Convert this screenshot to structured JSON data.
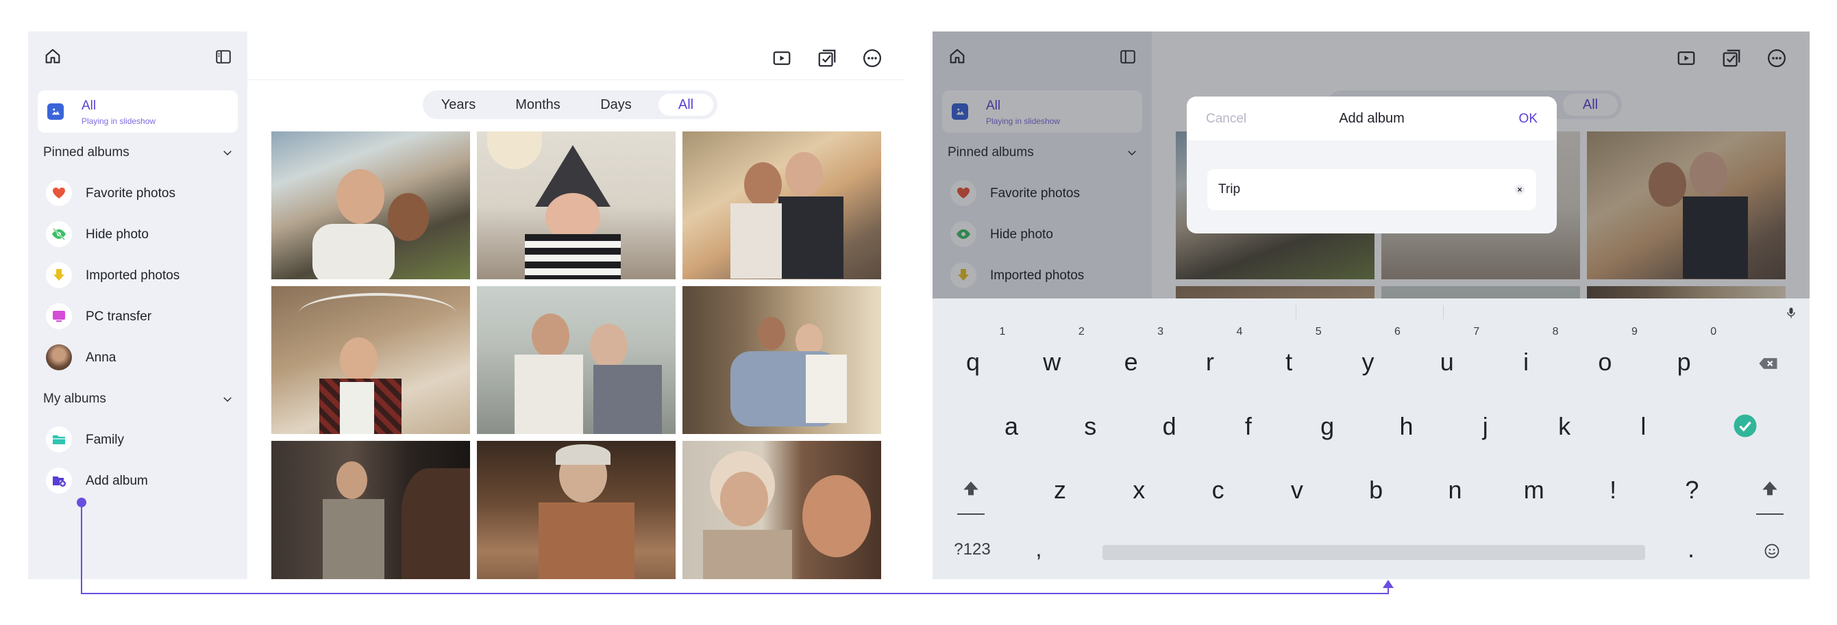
{
  "left_screen": {
    "sidebar": {
      "home_icon": "home-icon",
      "panel_icon": "sidebar-toggle-icon",
      "all": {
        "title": "All",
        "subtitle": "Playing in slideshow",
        "icon": "image-icon"
      },
      "pinned_header": "Pinned albums",
      "pinned": [
        {
          "label": "Favorite photos",
          "icon": "heart-icon",
          "color": "#e8553b"
        },
        {
          "label": "Hide photo",
          "icon": "eye-off-icon",
          "color": "#3cbf64"
        },
        {
          "label": "Imported photos",
          "icon": "download-arrow-icon",
          "color": "#e9c020"
        },
        {
          "label": "PC transfer",
          "icon": "monitor-icon",
          "color": "#d54cd8"
        },
        {
          "label": "Anna",
          "icon": "avatar-icon",
          "color": "#8a6a52"
        }
      ],
      "my_albums_header": "My albums",
      "my_albums": [
        {
          "label": "Family",
          "icon": "folder-icon",
          "color": "#2fc4b2"
        },
        {
          "label": "Add album",
          "icon": "add-folder-icon",
          "color": "#5b3fd6"
        }
      ]
    },
    "toolbar": {
      "slideshow_icon": "play-icon",
      "select_icon": "select-check-icon",
      "more_icon": "more-icon"
    },
    "tabs": [
      {
        "label": "Years",
        "selected": false
      },
      {
        "label": "Months",
        "selected": false
      },
      {
        "label": "Days",
        "selected": false
      },
      {
        "label": "All",
        "selected": true
      }
    ],
    "photos": [
      {
        "name": "photo-couple-selfie"
      },
      {
        "name": "photo-child-witch-hat"
      },
      {
        "name": "photo-couple-sofa"
      },
      {
        "name": "photo-man-thumbs-up"
      },
      {
        "name": "photo-father-son-table"
      },
      {
        "name": "photo-family-living-room"
      },
      {
        "name": "photo-older-man-doorway"
      },
      {
        "name": "photo-older-man-painting"
      },
      {
        "name": "photo-older-woman-young-man"
      }
    ]
  },
  "right_screen": {
    "sidebar": {
      "all": {
        "title": "All",
        "subtitle": "Playing in slideshow"
      },
      "pinned_header": "Pinned albums",
      "pinned": [
        {
          "label": "Favorite photos"
        },
        {
          "label": "Hide photo"
        },
        {
          "label": "Imported photos"
        }
      ]
    },
    "tab_all": "All",
    "dialog": {
      "cancel": "Cancel",
      "title": "Add album",
      "ok": "OK",
      "input_value": "Trip",
      "clear_icon": "clear-icon"
    },
    "keyboard": {
      "row1": [
        "q",
        "w",
        "e",
        "r",
        "t",
        "y",
        "u",
        "i",
        "o",
        "p"
      ],
      "row1_hints": [
        "1",
        "2",
        "3",
        "4",
        "5",
        "6",
        "7",
        "8",
        "9",
        "0"
      ],
      "row2": [
        "a",
        "s",
        "d",
        "f",
        "g",
        "h",
        "j",
        "k",
        "l"
      ],
      "row3": [
        "z",
        "x",
        "c",
        "v",
        "b",
        "n",
        "m",
        "!",
        "?"
      ],
      "symbols": "?123",
      "comma": ",",
      "period": ".",
      "backspace_icon": "backspace-icon",
      "enter_icon": "check-circle-icon",
      "shift_icon": "shift-icon",
      "mic_icon": "mic-icon",
      "emoji_icon": "emoji-icon",
      "accent": "#31b59a"
    }
  },
  "accent_color": "#6a4ee0"
}
